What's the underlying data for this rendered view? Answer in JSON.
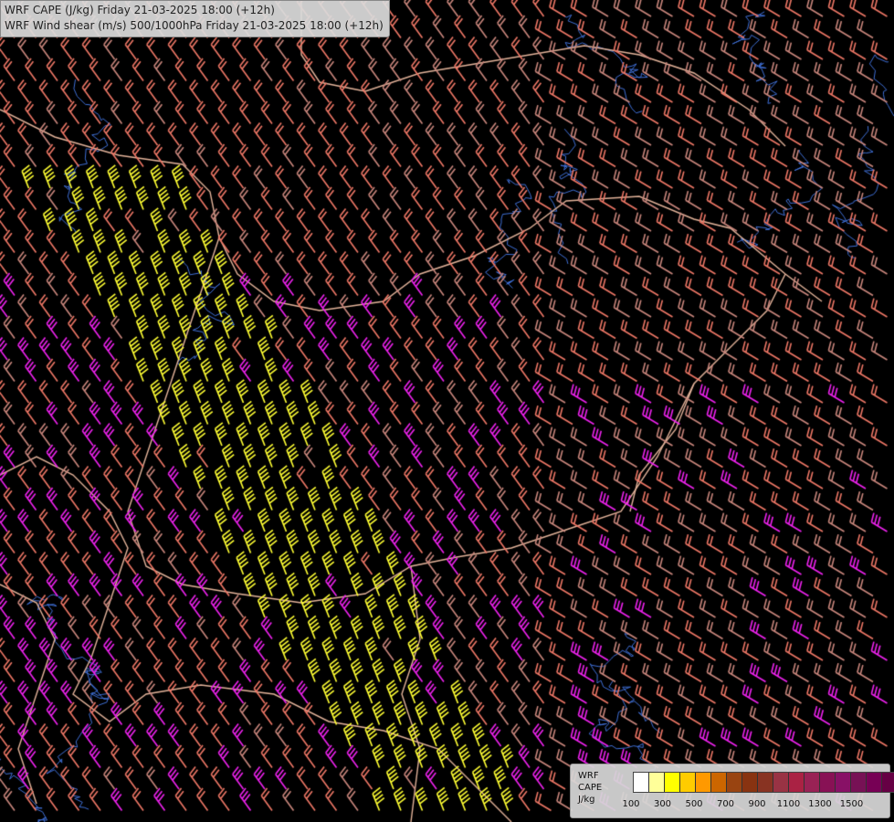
{
  "title": {
    "line1": "WRF CAPE (J/kg) Friday 21-03-2025 18:00 (+12h)",
    "line2": "WRF Wind shear (m/s) 500/1000hPa Friday 21-03-2025 18:00 (+12h)"
  },
  "legend": {
    "label_top": "WRF",
    "label_mid": "CAPE",
    "label_unit": "J/kg",
    "colors": [
      "#ffffff",
      "#ffff99",
      "#ffff00",
      "#ffcc00",
      "#ff9900",
      "#cc6600",
      "#994411",
      "#883311",
      "#883322",
      "#993344",
      "#aa2244",
      "#992255",
      "#881155",
      "#881166",
      "#771155",
      "#770055",
      "#660044"
    ],
    "ticks": [
      "100",
      "300",
      "500",
      "700",
      "900",
      "1100",
      "1300",
      "1500"
    ]
  },
  "map": {
    "background": "#000000",
    "barb_colors": {
      "low": "#c9867c",
      "mid": "#ee7766",
      "magenta": "#ee22ee",
      "yellow": "#ffff33"
    },
    "border_color": "#e3b39a",
    "river_color": "#3f6fd6"
  }
}
